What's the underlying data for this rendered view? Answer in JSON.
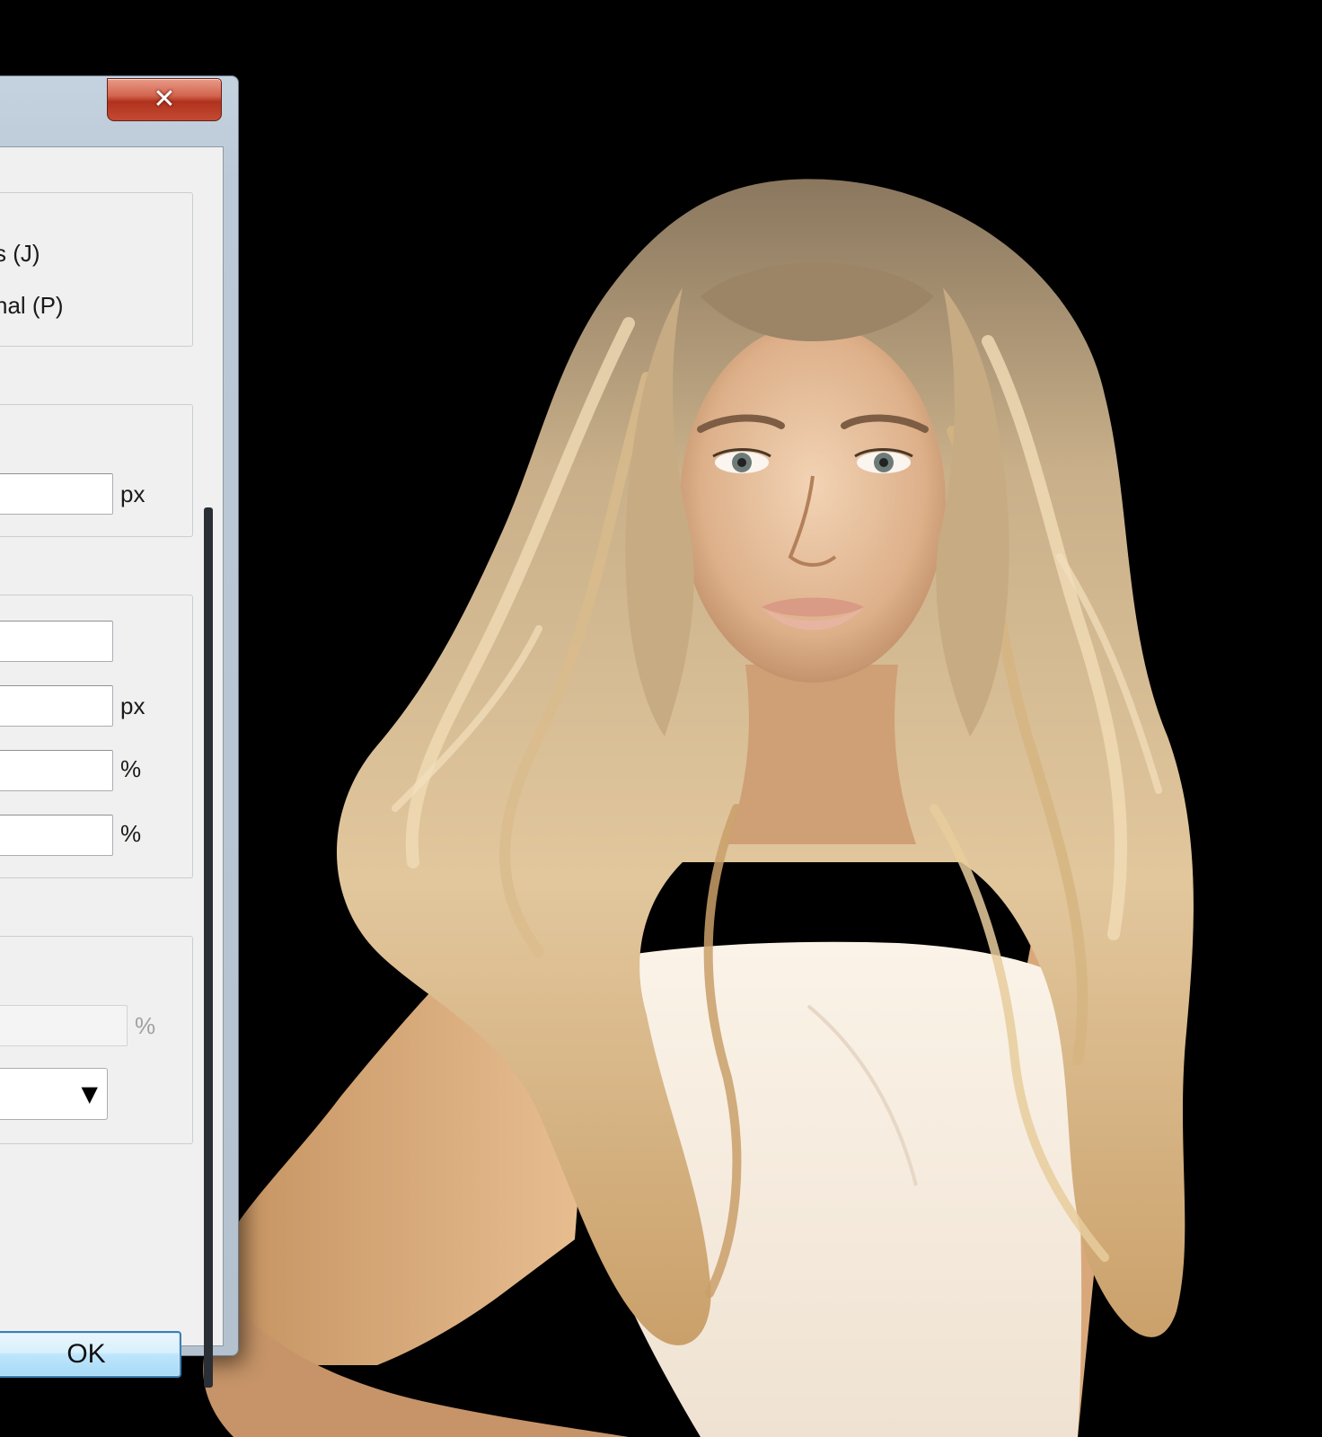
{
  "window": {
    "close_symbol": "✕",
    "close_icon": "close-icon"
  },
  "options_group": {
    "option_1_label": "s (J)",
    "option_2_label": "nal (P)"
  },
  "size_group": {
    "unit": "px"
  },
  "second_group": {
    "field_2_unit": "px",
    "field_3_unit": "%",
    "field_4_unit": "%"
  },
  "third_group": {
    "field_unit": "%",
    "dropdown_arrow": "▼"
  },
  "buttons": {
    "ok_label": "OK"
  },
  "colors": {
    "background": "#000000",
    "dialog_face": "#f0f0f0",
    "close_button": "#c34a33",
    "ok_border": "#3c7fb1"
  }
}
